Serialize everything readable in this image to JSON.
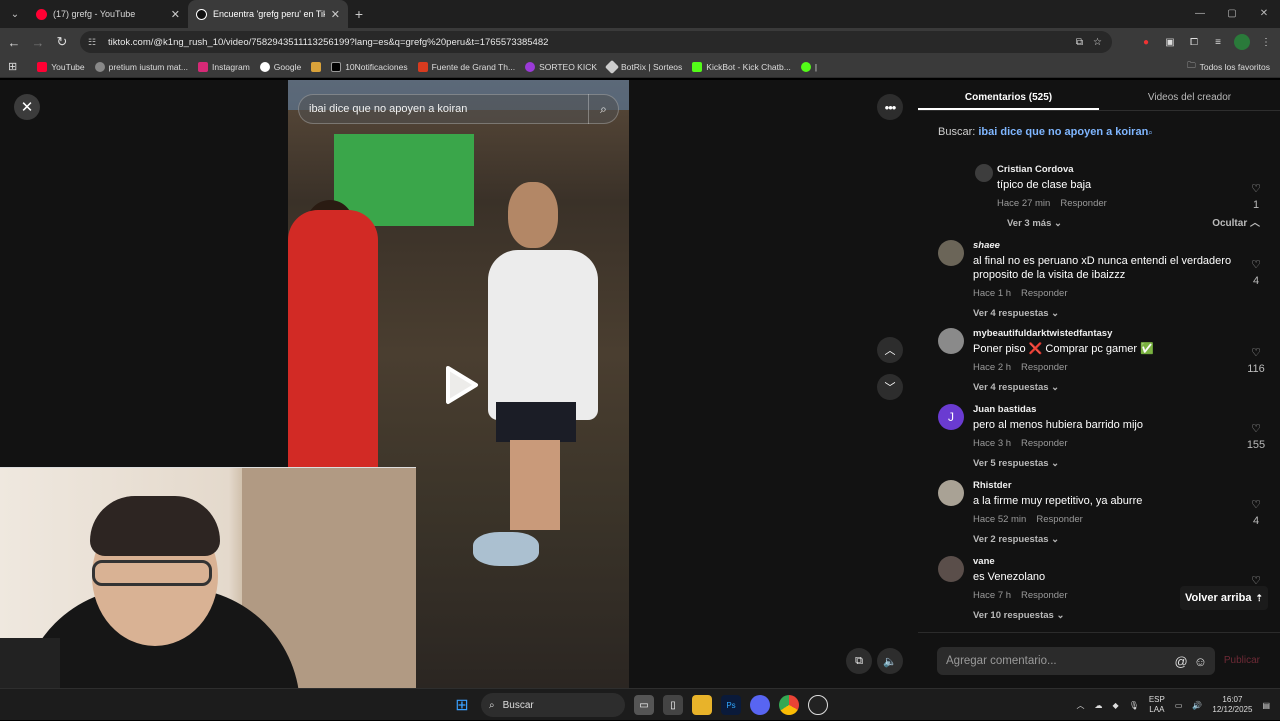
{
  "browser": {
    "tabs": [
      {
        "title": "(17) grefg - YouTube",
        "favicon_color": "#ff0033"
      },
      {
        "title": "Encuentra 'grefg peru' en TikTo",
        "favicon_color": "#111111"
      }
    ],
    "new_tab_symbol": "+",
    "url": "tiktok.com/@k1ng_rush_10/video/7582943511113256199?lang=es&q=grefg%20peru&t=1765573385482",
    "bookmarks": [
      {
        "label": "YouTube",
        "color": "#ff0033"
      },
      {
        "label": "pretium iustum mat...",
        "color": "#888888"
      },
      {
        "label": "Instagram",
        "color": "#d62976"
      },
      {
        "label": "Google",
        "color": "#4285f4"
      },
      {
        "label": "",
        "color": "#d9a23a"
      },
      {
        "label": "10Notificaciones",
        "color": "#000000"
      },
      {
        "label": "Fuente de Grand Th...",
        "color": "#d83b1f"
      },
      {
        "label": "SORTEO KICK",
        "color": "#9b3ad8"
      },
      {
        "label": "BotRix | Sorteos",
        "color": "#cccccc"
      },
      {
        "label": "KickBot - Kick Chatb...",
        "color": "#53fc18"
      },
      {
        "label": "|",
        "color": "#53fc18"
      }
    ],
    "all_favorites_label": "Todos los favoritos"
  },
  "video": {
    "search_text": "ibai dice que no apoyen a koiran"
  },
  "panel": {
    "tabs": [
      "Comentarios (525)",
      "Videos del creador"
    ],
    "search_prefix": "Buscar:",
    "search_query": "ibai dice que no apoyen a koiran",
    "hide_label": "Ocultar",
    "back_to_top": "Volver arriba",
    "comment_placeholder": "Agregar comentario...",
    "post_label": "Publicar",
    "reply_label": "Responder"
  },
  "comments": [
    {
      "user": "Cristian Cordova",
      "text": "típico de clase baja",
      "time": "Hace 27 min",
      "likes": "1",
      "replies": "Ver 3 más",
      "avatar_color": "#3d3d3d"
    },
    {
      "user": "shaee",
      "text": "al final no es peruano xD nunca entendi el verdadero proposito de la visita de ibaizzz",
      "time": "Hace 1 h",
      "likes": "4",
      "replies": "Ver 4 respuestas",
      "avatar_color": "#6b6558"
    },
    {
      "user": "mybeautifuldarktwistedfantasy",
      "text": "Poner piso ❌ Comprar pc gamer ✅",
      "time": "Hace 2 h",
      "likes": "116",
      "replies": "Ver 4 respuestas",
      "avatar_color": "#8a8a8a"
    },
    {
      "user": "Juan bastidas",
      "text": "pero al menos hubiera barrido mijo",
      "time": "Hace 3 h",
      "likes": "155",
      "replies": "Ver 5 respuestas",
      "avatar_color": "#6a3bd1",
      "avatar_letter": "J"
    },
    {
      "user": "Rhistder",
      "text": "a la firme muy repetitivo, ya aburre",
      "time": "Hace 52 min",
      "likes": "4",
      "replies": "Ver 2 respuestas",
      "avatar_color": "#a9a295"
    },
    {
      "user": "vane",
      "text": "es Venezolano",
      "time": "Hace 7 h",
      "likes": "",
      "replies": "Ver 10 respuestas",
      "avatar_color": "#5a4e4a"
    }
  ],
  "taskbar": {
    "search_label": "Buscar",
    "lang_top": "ESP",
    "lang_bottom": "LAA",
    "time": "16:07",
    "date": "12/12/2025"
  }
}
